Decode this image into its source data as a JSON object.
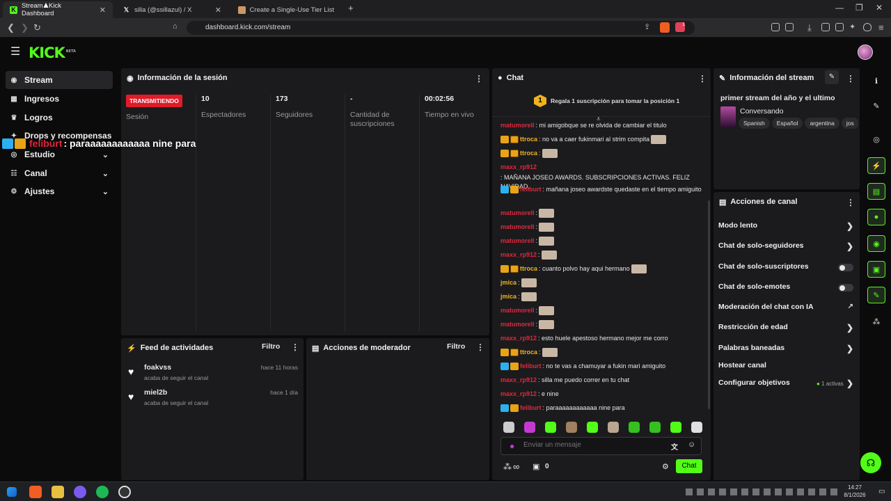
{
  "browser": {
    "tabs": [
      {
        "title": "Stream - Kick Dashboard",
        "active": true
      },
      {
        "title": "silla (@ssillazul) / X",
        "active": false
      },
      {
        "title": "Create a Single-Use Tier List (Private",
        "active": false
      }
    ],
    "new_tab_label": "+",
    "url": "dashboard.kick.com/stream",
    "notification_count": "1"
  },
  "header": {
    "logo": "KICK",
    "logo_sup": "BETA"
  },
  "sidebar": {
    "items": [
      {
        "label": "Stream",
        "icon": "stream-icon"
      },
      {
        "label": "Ingresos",
        "icon": "money-icon"
      },
      {
        "label": "Logros",
        "icon": "trophy-icon"
      },
      {
        "label": "Drops y recompensas",
        "icon": "gift-icon"
      },
      {
        "label": "Estudio",
        "icon": "camera-icon"
      },
      {
        "label": "Canal",
        "icon": "users-icon"
      },
      {
        "label": "Ajustes",
        "icon": "gear-icon"
      }
    ]
  },
  "overlay_message": {
    "user": "feliburt",
    "text": ": paraaaaaaaaaaaa nine para"
  },
  "session": {
    "title": "Información de la sesión",
    "live_badge": "TRANSMITIENDO",
    "session_label": "Sesión",
    "stats": [
      {
        "value": "10",
        "label": "Espectadores"
      },
      {
        "value": "173",
        "label": "Seguidores"
      },
      {
        "value": "-",
        "label": "Cantidad de suscripciones"
      },
      {
        "value": "00:02:56",
        "label": "Tiempo en vivo"
      }
    ]
  },
  "activity_feed": {
    "title": "Feed de actividades",
    "filter": "Filtro",
    "items": [
      {
        "name": "foakvss",
        "sub": "acaba de seguir el canal",
        "time": "hace 11 horas"
      },
      {
        "name": "miel2b",
        "sub": "acaba de seguir el canal",
        "time": "hace 1 día"
      }
    ]
  },
  "mod_actions": {
    "title": "Acciones de moderador",
    "filter": "Filtro"
  },
  "chat": {
    "title": "Chat",
    "gift_rank": "1",
    "gift_text": "Regala 1 suscripción para tomar la posición 1",
    "messages": [
      {
        "user": "matumorell",
        "color": "red",
        "text": ": mi amigobque se re olvida de cambiar el titulo"
      },
      {
        "user": "ttroca",
        "color": "gold",
        "badges": [
          "gold",
          "orange"
        ],
        "text": ": no va a caer fukinmari al strim compita"
      },
      {
        "user": "ttroca",
        "color": "gold",
        "badges": [
          "gold",
          "orange"
        ],
        "text": ":"
      },
      {
        "user": "maxx_rp912",
        "color": "red",
        "text": ": MAÑANA JOSEO AWARDS. SUBSCRIPCIONES ACTIVAS. FELIZ NAVIDAD."
      },
      {
        "user": "feliburt",
        "color": "red",
        "badges": [
          "blue",
          "gold"
        ],
        "text": ": mañana joseo awardste quedaste en el tiempo amiguito"
      },
      {
        "user": "matumorell",
        "color": "red",
        "text": ":"
      },
      {
        "user": "matumorell",
        "color": "red",
        "text": ":"
      },
      {
        "user": "matumorell",
        "color": "red",
        "text": ":"
      },
      {
        "user": "maxx_rp912",
        "color": "red",
        "text": ":"
      },
      {
        "user": "ttroca",
        "color": "gold",
        "badges": [
          "gold",
          "orange"
        ],
        "text": ": cuanto polvo hay aqui hermano"
      },
      {
        "user": "jmica",
        "color": "gold",
        "text": ":"
      },
      {
        "user": "jmica",
        "color": "gold",
        "text": ":"
      },
      {
        "user": "matumorell",
        "color": "red",
        "text": ":"
      },
      {
        "user": "matumorell",
        "color": "red",
        "text": ":"
      },
      {
        "user": "maxx_rp912",
        "color": "red",
        "text": ": esto huele apestoso hermano mejor me corro"
      },
      {
        "user": "ttroca",
        "color": "gold",
        "badges": [
          "gold",
          "orange"
        ],
        "text": ":"
      },
      {
        "user": "feliburt",
        "color": "red",
        "badges": [
          "blue",
          "gold"
        ],
        "text": ": no te vas a chamuyar a fukin mari amiguito"
      },
      {
        "user": "maxx_rp912",
        "color": "red",
        "text": ": silla me puedo correr en tu chat"
      },
      {
        "user": "maxx_rp912",
        "color": "red",
        "text": ": e nine"
      },
      {
        "user": "feliburt",
        "color": "red",
        "badges": [
          "blue",
          "gold"
        ],
        "text": ": paraaaaaaaaaaaa nine para"
      }
    ],
    "input_placeholder": "Enviar un mensaje",
    "infinity_label": "∞",
    "gift_count": "0",
    "send_label": "Chat"
  },
  "stream_info": {
    "title": "Información del stream",
    "stream_title": "primer stream del año y el ultimo",
    "category": "Conversando",
    "tags": [
      "Spanish",
      "Español",
      "argentina",
      "jos"
    ]
  },
  "channel_actions": {
    "title": "Acciones de canal",
    "items": [
      {
        "label": "Modo lento",
        "control": "chevron"
      },
      {
        "label": "Chat de solo-seguidores",
        "control": "chevron"
      },
      {
        "label": "Chat de solo-suscriptores",
        "control": "toggle"
      },
      {
        "label": "Chat de solo-emotes",
        "control": "toggle"
      },
      {
        "label": "Moderación del chat con IA",
        "control": "external"
      },
      {
        "label": "Restricción de edad",
        "control": "chevron"
      },
      {
        "label": "Palabras baneadas",
        "control": "chevron"
      },
      {
        "label": "Hostear canal",
        "control": "none"
      },
      {
        "label": "Configurar objetivos",
        "control": "chevron",
        "note": "1 activas"
      }
    ]
  },
  "taskbar": {
    "time": "14:27",
    "date": "8/1/2026"
  },
  "colors": {
    "accent": "#53fc18",
    "live": "#e01b2a",
    "panel": "#1b1b1d"
  }
}
